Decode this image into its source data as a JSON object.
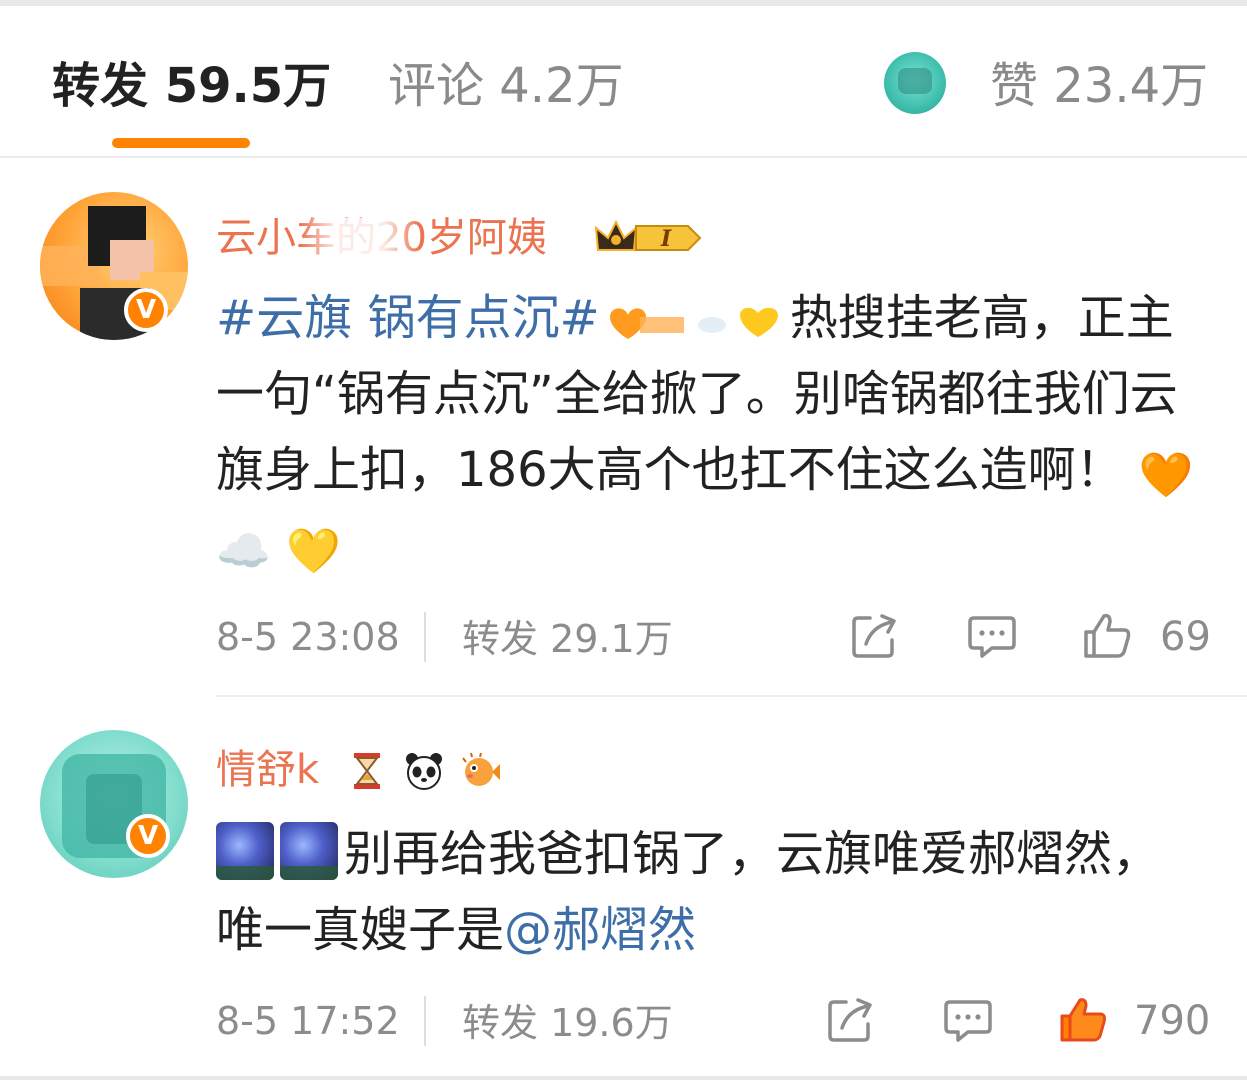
{
  "tabs": {
    "repost": "转发 59.5万",
    "comments": "评论 4.2万",
    "likes": "赞 23.4万"
  },
  "colors": {
    "accent": "#ff8200",
    "username": "#eb7350",
    "link": "#3e6ea8",
    "muted": "#8c8c8c"
  },
  "reposts": [
    {
      "username": "云小车的20岁阿姨",
      "verified_badge": "V",
      "member_badge": "I",
      "hashtag": "#云旗 锅有点沉#",
      "text": "热搜挂老高，正主一句“锅有点沉”全给掀了。别啥锅都往我们云旗身上扣，186大高个也扛不住这么造啊！",
      "trailing_emoji": [
        "🧡",
        "☁️",
        "💛"
      ],
      "time": "8-5 23:08",
      "repost_count": "转发 29.1万",
      "like_count": "69",
      "liked": false
    },
    {
      "username": "情舒k",
      "verified_badge": "V",
      "name_icons": [
        "hourglass-icon",
        "panda-icon",
        "pufferfish-icon"
      ],
      "text": "别再给我爸扣锅了，云旗唯爱郝熠然，唯一真嫂子是",
      "mention": "@郝熠然",
      "time": "8-5 17:52",
      "repost_count": "转发 19.6万",
      "like_count": "790",
      "liked": true
    }
  ]
}
